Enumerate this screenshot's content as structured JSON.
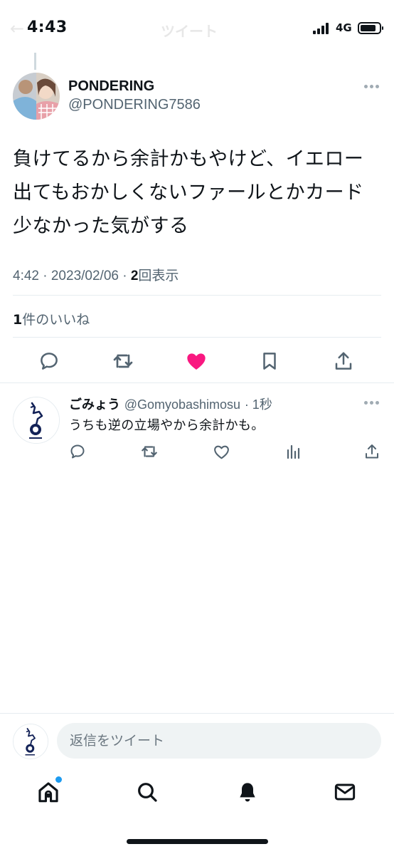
{
  "status_bar": {
    "time": "4:43",
    "network": "4G",
    "battery_level": 0.85
  },
  "header": {
    "title": "ツイート",
    "back_label": "←"
  },
  "tweet": {
    "author_name": "PONDERING",
    "author_handle": "@PONDERING7586",
    "text": "負けてるから余計かもやけど、イエロー出てもおかしくないファールとかカード少なかった気がする",
    "time": "4:42 · 2023/02/06 · ",
    "views_count": "2",
    "views_label": "回表示",
    "likes_count": "1",
    "likes_label": "件のいいね",
    "liked": true,
    "like_color": "#f91880"
  },
  "reply": {
    "author_name": "ごみょう",
    "author_handle": "@Gomyobashimosu",
    "time": "· 1秒",
    "text": "うちも逆の立場やから余計かも。"
  },
  "compose": {
    "placeholder": "返信をツイート"
  },
  "tabs": [
    "home-icon",
    "search-icon",
    "notifications-icon",
    "messages-icon"
  ],
  "colors": {
    "accent": "#1d9bf0",
    "text": "#0f1419",
    "secondary": "#536471"
  }
}
